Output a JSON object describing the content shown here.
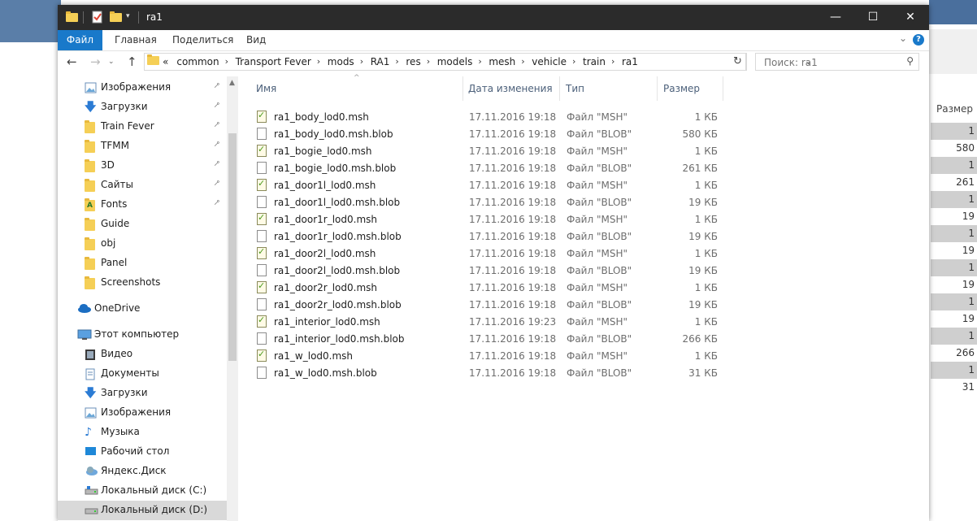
{
  "window": {
    "title": "ra1"
  },
  "ribbon": {
    "tabs": [
      "Файл",
      "Главная",
      "Поделиться",
      "Вид"
    ]
  },
  "address": {
    "crumbs": [
      "«",
      "common",
      "Transport Fever",
      "mods",
      "RA1",
      "res",
      "models",
      "mesh",
      "vehicle",
      "train",
      "ra1"
    ]
  },
  "search": {
    "placeholder": "Поиск: ra1"
  },
  "sidebar": {
    "items": [
      {
        "label": "Изображения",
        "icon": "pictures-icon",
        "pinned": true
      },
      {
        "label": "Загрузки",
        "icon": "download-icon",
        "pinned": true
      },
      {
        "label": "Train Fever",
        "icon": "folder-icon",
        "pinned": true
      },
      {
        "label": "TFMM",
        "icon": "folder-icon",
        "pinned": true
      },
      {
        "label": "3D",
        "icon": "folder-icon",
        "pinned": true
      },
      {
        "label": "Сайты",
        "icon": "folder-icon",
        "pinned": true
      },
      {
        "label": "Fonts",
        "icon": "fonts-folder-icon",
        "pinned": true
      },
      {
        "label": "Guide",
        "icon": "folder-icon",
        "pinned": false
      },
      {
        "label": "obj",
        "icon": "folder-icon",
        "pinned": false
      },
      {
        "label": "Panel",
        "icon": "folder-icon",
        "pinned": false
      },
      {
        "label": "Screenshots",
        "icon": "folder-icon",
        "pinned": false
      },
      {
        "label": "OneDrive",
        "icon": "cloud-icon",
        "pinned": false
      },
      {
        "label": "Этот компьютер",
        "icon": "computer-icon",
        "pinned": false
      },
      {
        "label": "Видео",
        "icon": "video-icon",
        "pinned": false
      },
      {
        "label": "Документы",
        "icon": "documents-icon",
        "pinned": false
      },
      {
        "label": "Загрузки",
        "icon": "download-icon",
        "pinned": false
      },
      {
        "label": "Изображения",
        "icon": "pictures-icon",
        "pinned": false
      },
      {
        "label": "Музыка",
        "icon": "music-icon",
        "pinned": false
      },
      {
        "label": "Рабочий стол",
        "icon": "desktop-icon",
        "pinned": false
      },
      {
        "label": "Яндекс.Диск",
        "icon": "yandex-disk-icon",
        "pinned": false
      },
      {
        "label": "Локальный диск (C:)",
        "icon": "drive-icon",
        "pinned": false
      },
      {
        "label": "Локальный диск (D:)",
        "icon": "drive-icon",
        "pinned": false,
        "selected": true
      }
    ]
  },
  "columns": {
    "name": "Имя",
    "date": "Дата изменения",
    "type": "Тип",
    "size": "Размер"
  },
  "files": [
    {
      "name": "ra1_body_lod0.msh",
      "date": "17.11.2016 19:18",
      "type": "Файл \"MSH\"",
      "size": "1 КБ",
      "kind": "msh"
    },
    {
      "name": "ra1_body_lod0.msh.blob",
      "date": "17.11.2016 19:18",
      "type": "Файл \"BLOB\"",
      "size": "580 КБ",
      "kind": "blob"
    },
    {
      "name": "ra1_bogie_lod0.msh",
      "date": "17.11.2016 19:18",
      "type": "Файл \"MSH\"",
      "size": "1 КБ",
      "kind": "msh"
    },
    {
      "name": "ra1_bogie_lod0.msh.blob",
      "date": "17.11.2016 19:18",
      "type": "Файл \"BLOB\"",
      "size": "261 КБ",
      "kind": "blob"
    },
    {
      "name": "ra1_door1l_lod0.msh",
      "date": "17.11.2016 19:18",
      "type": "Файл \"MSH\"",
      "size": "1 КБ",
      "kind": "msh"
    },
    {
      "name": "ra1_door1l_lod0.msh.blob",
      "date": "17.11.2016 19:18",
      "type": "Файл \"BLOB\"",
      "size": "19 КБ",
      "kind": "blob"
    },
    {
      "name": "ra1_door1r_lod0.msh",
      "date": "17.11.2016 19:18",
      "type": "Файл \"MSH\"",
      "size": "1 КБ",
      "kind": "msh"
    },
    {
      "name": "ra1_door1r_lod0.msh.blob",
      "date": "17.11.2016 19:18",
      "type": "Файл \"BLOB\"",
      "size": "19 КБ",
      "kind": "blob"
    },
    {
      "name": "ra1_door2l_lod0.msh",
      "date": "17.11.2016 19:18",
      "type": "Файл \"MSH\"",
      "size": "1 КБ",
      "kind": "msh"
    },
    {
      "name": "ra1_door2l_lod0.msh.blob",
      "date": "17.11.2016 19:18",
      "type": "Файл \"BLOB\"",
      "size": "19 КБ",
      "kind": "blob"
    },
    {
      "name": "ra1_door2r_lod0.msh",
      "date": "17.11.2016 19:18",
      "type": "Файл \"MSH\"",
      "size": "1 КБ",
      "kind": "msh"
    },
    {
      "name": "ra1_door2r_lod0.msh.blob",
      "date": "17.11.2016 19:18",
      "type": "Файл \"BLOB\"",
      "size": "19 КБ",
      "kind": "blob"
    },
    {
      "name": "ra1_interior_lod0.msh",
      "date": "17.11.2016 19:23",
      "type": "Файл \"MSH\"",
      "size": "1 КБ",
      "kind": "msh"
    },
    {
      "name": "ra1_interior_lod0.msh.blob",
      "date": "17.11.2016 19:18",
      "type": "Файл \"BLOB\"",
      "size": "266 КБ",
      "kind": "blob"
    },
    {
      "name": "ra1_w_lod0.msh",
      "date": "17.11.2016 19:18",
      "type": "Файл \"MSH\"",
      "size": "1 КБ",
      "kind": "msh"
    },
    {
      "name": "ra1_w_lod0.msh.blob",
      "date": "17.11.2016 19:18",
      "type": "Файл \"BLOB\"",
      "size": "31 КБ",
      "kind": "blob"
    }
  ],
  "background_window": {
    "header": "Размер",
    "sizes": [
      "1",
      "580",
      "1",
      "261",
      "1",
      "19",
      "1",
      "19",
      "1",
      "19",
      "1",
      "19",
      "1",
      "266",
      "1",
      "31"
    ]
  },
  "colors": {
    "accent": "#1979ca",
    "titlebar": "#2b2b2b",
    "folder": "#f5cf56"
  }
}
